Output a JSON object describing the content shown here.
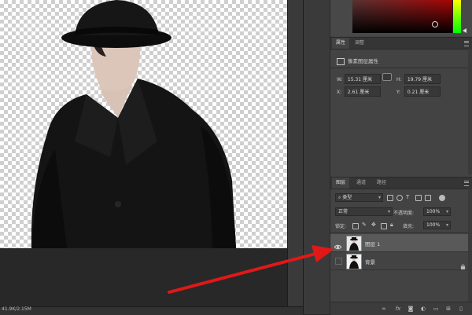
{
  "status": {
    "doc_info": "41.9K/2.15M"
  },
  "color_panel": {
    "accent": "#b00000",
    "hue_top": "#ffff00",
    "hue_bottom": "#00ff00"
  },
  "properties_panel": {
    "tabs": [
      {
        "label": "属性",
        "active": true
      },
      {
        "label": "调整",
        "active": false
      }
    ],
    "header": "像素图层属性",
    "width_label": "W:",
    "width_value": "15.31 厘米",
    "height_label": "H:",
    "height_value": "19.79 厘米",
    "x_label": "X:",
    "x_value": "2.61 厘米",
    "y_label": "Y:",
    "y_value": "0.21 厘米"
  },
  "layers_panel": {
    "tabs": [
      {
        "label": "图层",
        "active": true
      },
      {
        "label": "通道",
        "active": false
      },
      {
        "label": "路径",
        "active": false
      }
    ],
    "filter_label": "类型",
    "blend_mode": "正常",
    "opacity_label": "不透明度:",
    "opacity_value": "100%",
    "lock_label": "锁定:",
    "fill_label": "填充:",
    "fill_value": "100%",
    "layers": [
      {
        "name": "图层 1",
        "visible": true,
        "selected": true,
        "locked": false
      },
      {
        "name": "背景",
        "visible": false,
        "selected": false,
        "locked": true
      }
    ],
    "bottom_icons": [
      "link-icon",
      "fx-icon",
      "mask-icon",
      "adjustment-icon",
      "folder-icon",
      "new-layer-icon",
      "trash-icon"
    ]
  },
  "annotation": {
    "arrow_color": "#e01818"
  }
}
